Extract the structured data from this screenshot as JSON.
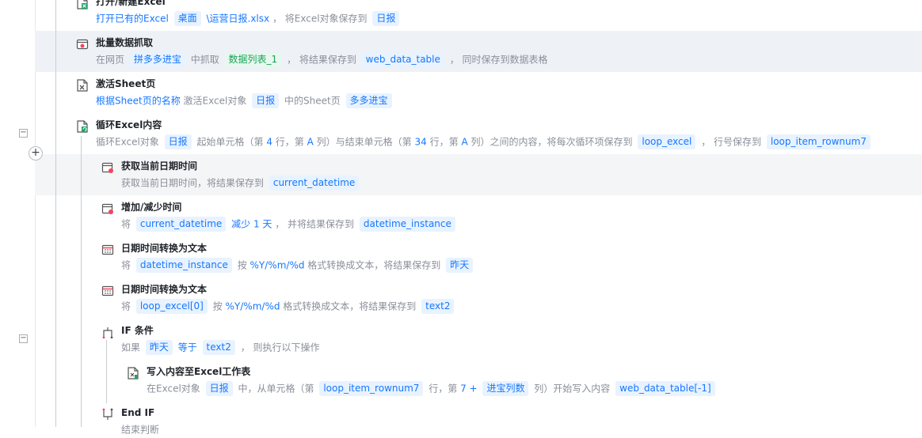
{
  "steps": [
    {
      "title": "打开/新建Excel",
      "desc": [
        {
          "t": "打开已有的Excel",
          "k": "blue"
        },
        {
          "t": "桌面",
          "k": "tag"
        },
        {
          "t": "\\运营日报.xlsx",
          "k": "blue"
        },
        {
          "t": "， 将Excel对象保存到",
          "k": "plain"
        },
        {
          "t": "日报",
          "k": "tag"
        }
      ]
    },
    {
      "title": "批量数据抓取",
      "desc": [
        {
          "t": "在网页",
          "k": "plain"
        },
        {
          "t": "拼多多进宝",
          "k": "tag"
        },
        {
          "t": "中抓取",
          "k": "plain"
        },
        {
          "t": "数据列表_1",
          "k": "tag-green"
        },
        {
          "t": "， 将结果保存到",
          "k": "plain"
        },
        {
          "t": "web_data_table",
          "k": "tag"
        },
        {
          "t": "， 同时保存到数据表格",
          "k": "plain"
        }
      ]
    },
    {
      "title": "激活Sheet页",
      "desc": [
        {
          "t": "根据Sheet页的名称",
          "k": "blue"
        },
        {
          "t": "激活Excel对象",
          "k": "plain"
        },
        {
          "t": "日报",
          "k": "tag"
        },
        {
          "t": "中的Sheet页",
          "k": "plain"
        },
        {
          "t": "多多进宝",
          "k": "tag"
        }
      ]
    },
    {
      "title": "循环Excel内容",
      "desc": [
        {
          "t": "循环Excel对象",
          "k": "plain"
        },
        {
          "t": "日报",
          "k": "tag"
        },
        {
          "t": "起始单元格（第",
          "k": "plain"
        },
        {
          "t": "4",
          "k": "blue"
        },
        {
          "t": "行，第",
          "k": "plain"
        },
        {
          "t": "A",
          "k": "blue"
        },
        {
          "t": "列）与结束单元格（第",
          "k": "plain"
        },
        {
          "t": "34",
          "k": "blue"
        },
        {
          "t": "行，第",
          "k": "plain"
        },
        {
          "t": "A",
          "k": "blue"
        },
        {
          "t": "列）之间的内容，将每次循环项保存到",
          "k": "plain"
        },
        {
          "t": "loop_excel",
          "k": "tag"
        },
        {
          "t": "， 行号保存到",
          "k": "plain"
        },
        {
          "t": "loop_item_rownum7",
          "k": "tag"
        }
      ]
    },
    {
      "title": "获取当前日期时间",
      "desc": [
        {
          "t": "获取当前日期时间，将结果保存到",
          "k": "plain"
        },
        {
          "t": "current_datetime",
          "k": "tag"
        }
      ]
    },
    {
      "title": "增加/减少时间",
      "desc": [
        {
          "t": "将",
          "k": "plain"
        },
        {
          "t": "current_datetime",
          "k": "tag"
        },
        {
          "t": "减少 1 天",
          "k": "blue"
        },
        {
          "t": "， 并将结果保存到",
          "k": "plain"
        },
        {
          "t": "datetime_instance",
          "k": "tag"
        }
      ]
    },
    {
      "title": "日期时间转换为文本",
      "desc": [
        {
          "t": "将",
          "k": "plain"
        },
        {
          "t": "datetime_instance",
          "k": "tag"
        },
        {
          "t": "按",
          "k": "plain"
        },
        {
          "t": "%Y/%m/%d",
          "k": "blue"
        },
        {
          "t": "格式转换成文本，将结果保存到",
          "k": "plain"
        },
        {
          "t": "昨天",
          "k": "tag"
        }
      ]
    },
    {
      "title": "日期时间转换为文本",
      "desc": [
        {
          "t": "将",
          "k": "plain"
        },
        {
          "t": "loop_excel[0]",
          "k": "tag"
        },
        {
          "t": "按",
          "k": "plain"
        },
        {
          "t": "%Y/%m/%d",
          "k": "blue"
        },
        {
          "t": "格式转换成文本，将结果保存到",
          "k": "plain"
        },
        {
          "t": "text2",
          "k": "tag"
        }
      ]
    },
    {
      "title": "IF 条件",
      "desc": [
        {
          "t": "如果",
          "k": "plain"
        },
        {
          "t": "昨天",
          "k": "tag"
        },
        {
          "t": "等于",
          "k": "blue"
        },
        {
          "t": "text2",
          "k": "tag"
        },
        {
          "t": "， 则执行以下操作",
          "k": "plain"
        }
      ]
    },
    {
      "title": "写入内容至Excel工作表",
      "desc": [
        {
          "t": "在Excel对象",
          "k": "plain"
        },
        {
          "t": "日报",
          "k": "tag"
        },
        {
          "t": "中，从单元格（第",
          "k": "plain"
        },
        {
          "t": "loop_item_rownum7",
          "k": "tag"
        },
        {
          "t": "行，第",
          "k": "plain"
        },
        {
          "t": "7 +",
          "k": "blue"
        },
        {
          "t": "进宝列数",
          "k": "tag"
        },
        {
          "t": "列）开始写入内容",
          "k": "plain"
        },
        {
          "t": "web_data_table[-1]",
          "k": "tag"
        }
      ]
    },
    {
      "title": "End IF",
      "desc": [
        {
          "t": "结束判断",
          "k": "plain"
        }
      ]
    }
  ],
  "controls": {
    "collapse_glyph": "−",
    "add_glyph": "+"
  },
  "icons": [
    "excel-open-icon",
    "web-scrape-icon",
    "excel-sheet-icon",
    "excel-loop-icon",
    "calendar-icon",
    "calendar-icon",
    "calendar-text-icon",
    "calendar-text-icon",
    "if-branch-icon",
    "excel-write-icon",
    "end-if-icon"
  ],
  "colors": {
    "accent": "#1677ff",
    "tag_bg": "#e8f3ff",
    "green": "#19a55a",
    "highlight": "#eef1f6"
  }
}
